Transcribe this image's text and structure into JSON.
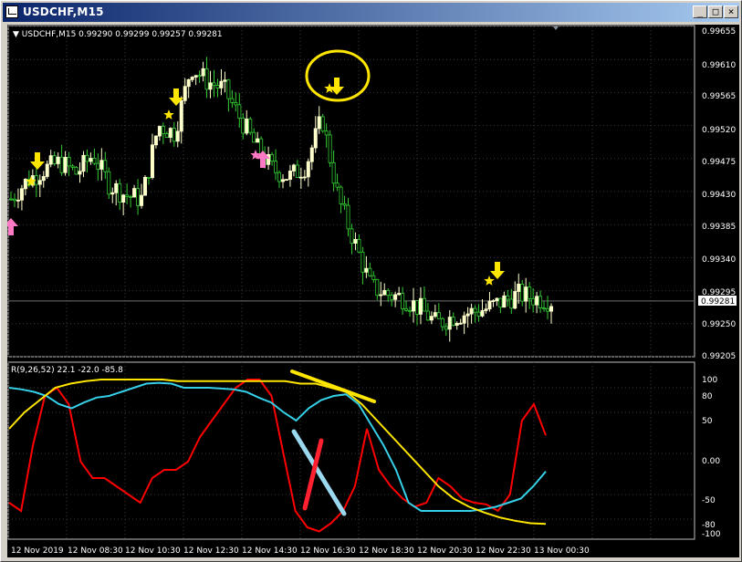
{
  "window": {
    "title": "USDCHF,M15",
    "minimize_label": "_",
    "maximize_label": "□",
    "close_label": "×"
  },
  "price_chart": {
    "info_label": "▼ USDCHF,M15  0.99290 0.99299 0.99257 0.99281",
    "current_price": "0.99281",
    "price_axis": [
      "0.99655",
      "0.99610",
      "0.99565",
      "0.99520",
      "0.99475",
      "0.99430",
      "0.99385",
      "0.99340",
      "0.99295",
      "0.99250",
      "0.99205"
    ]
  },
  "indicator": {
    "label": "R(9,26,52) 22.1 -22.0 -85.8",
    "axis": [
      "100",
      "80",
      "50",
      "0.00",
      "-50",
      "-80",
      "-100"
    ]
  },
  "time_axis": [
    "12 Nov 2019",
    "12 Nov 08:30",
    "12 Nov 10:30",
    "12 Nov 12:30",
    "12 Nov 14:30",
    "12 Nov 16:30",
    "12 Nov 18:30",
    "12 Nov 20:30",
    "12 Nov 22:30",
    "13 Nov 00:30"
  ],
  "colors": {
    "background": "#000000",
    "bull_candle": "#ffffcc",
    "bear_candle": "#32cd32",
    "red_line": "#ff0000",
    "cyan_line": "#35d0e8",
    "yellow_line": "#ffe600",
    "arrow_yellow": "#ffe600",
    "arrow_pink": "#ff7ac4"
  },
  "chart_data": [
    {
      "type": "candlestick",
      "symbol": "USDCHF",
      "timeframe": "M15",
      "ylim": [
        0.99205,
        0.99655
      ],
      "last_close": 0.99281,
      "close_path": [
        0.9942,
        0.99445,
        0.9946,
        0.9947,
        0.99455,
        0.9948,
        0.9944,
        0.99425,
        0.9942,
        0.9952,
        0.9951,
        0.996,
        0.9958,
        0.9957,
        0.9953,
        0.9949,
        0.9946,
        0.9945,
        0.99465,
        0.9953,
        0.9942,
        0.9936,
        0.993,
        0.9929,
        0.99285,
        0.9927,
        0.9925,
        0.9926,
        0.99265,
        0.9927,
        0.9928,
        0.9929,
        0.99285,
        0.99281
      ],
      "x": [
        "12 Nov 2019",
        "12 Nov 08:30",
        "12 Nov 10:30",
        "12 Nov 12:30",
        "12 Nov 14:30",
        "12 Nov 16:30",
        "12 Nov 18:30",
        "12 Nov 20:30",
        "12 Nov 22:30",
        "13 Nov 00:30"
      ]
    },
    {
      "type": "line",
      "title": "R(9,26,52) 22.1 -22.0 -85.8",
      "ylim": [
        -100,
        100
      ],
      "series": [
        {
          "name": "R(9)",
          "color": "#ff0000",
          "values": [
            -60,
            -70,
            10,
            70,
            80,
            60,
            -10,
            -30,
            -30,
            -40,
            -50,
            -60,
            -30,
            -20,
            -20,
            -10,
            20,
            40,
            60,
            80,
            90,
            90,
            70,
            0,
            -70,
            -90,
            -95,
            -85,
            -70,
            -40,
            30,
            -20,
            -40,
            -55,
            -65,
            -60,
            -30,
            -40,
            -55,
            -60,
            -62,
            -70,
            -50,
            40,
            60,
            22
          ]
        },
        {
          "name": "R(26)",
          "color": "#35d0e8",
          "values": [
            80,
            78,
            75,
            70,
            60,
            55,
            62,
            68,
            70,
            75,
            80,
            85,
            86,
            85,
            80,
            80,
            80,
            79,
            78,
            75,
            68,
            62,
            50,
            40,
            55,
            65,
            70,
            72,
            60,
            35,
            10,
            -20,
            -60,
            -70,
            -70,
            -70,
            -70,
            -70,
            -68,
            -65,
            -60,
            -55,
            -40,
            -22
          ]
        },
        {
          "name": "R(52)",
          "color": "#ffe600",
          "values": [
            30,
            50,
            65,
            80,
            85,
            88,
            90,
            90,
            90,
            90,
            90,
            88,
            88,
            88,
            88,
            88,
            88,
            88,
            88,
            85,
            85,
            80,
            75,
            60,
            40,
            20,
            0,
            -20,
            -40,
            -55,
            -65,
            -72,
            -78,
            -82,
            -85,
            -85.8
          ]
        }
      ]
    }
  ]
}
